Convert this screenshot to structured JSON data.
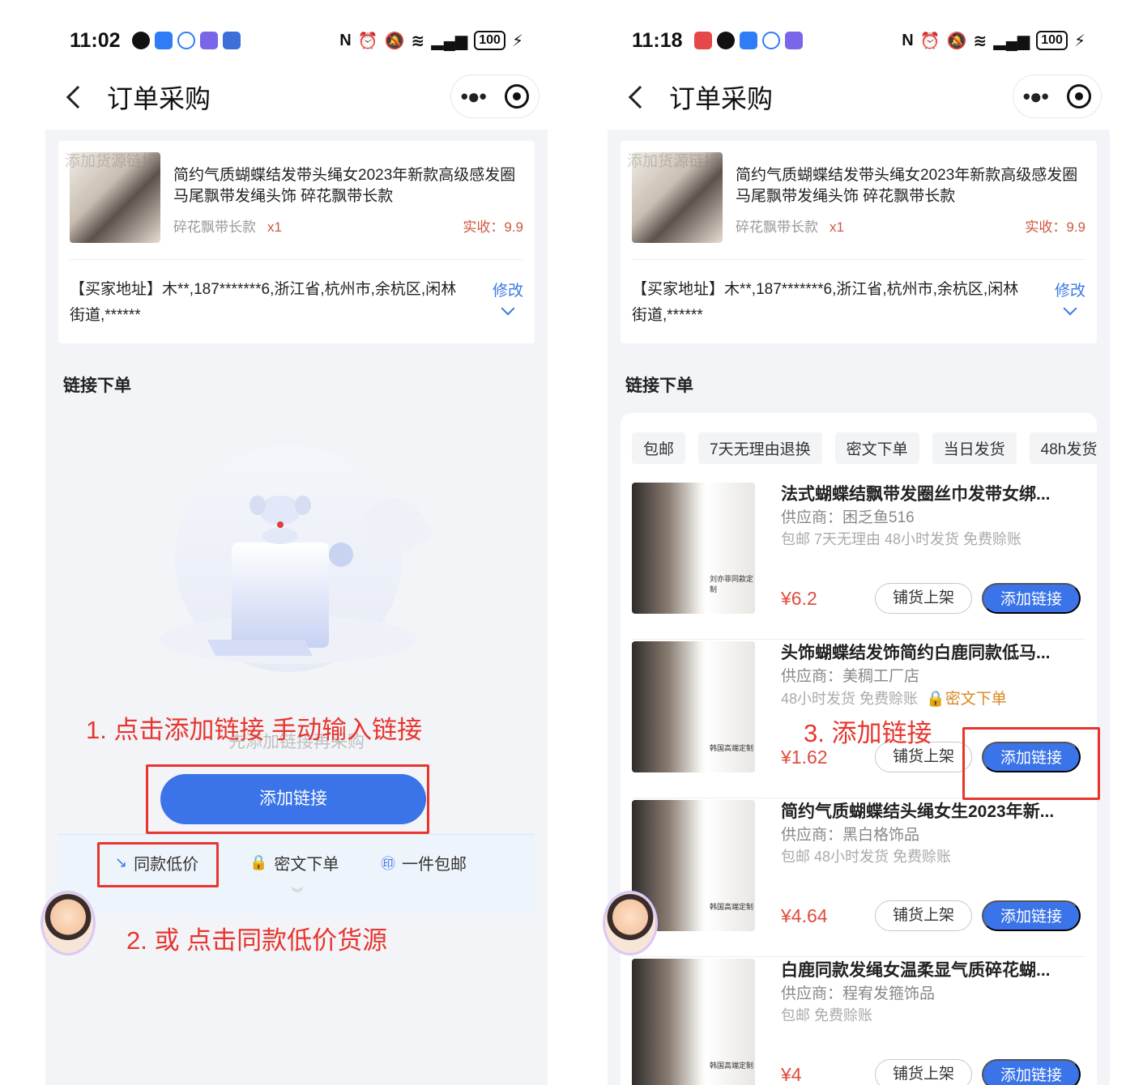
{
  "left": {
    "status": {
      "time": "11:02",
      "battery": "100"
    },
    "nav": {
      "title": "订单采购"
    },
    "order": {
      "watermark": "添加货源链接",
      "title": "简约气质蝴蝶结发带头绳女2023年新款高级感发圈马尾飘带发绳头饰 碎花飘带长款",
      "spec": "碎花飘带长款",
      "qty": "x1",
      "paid": "实收：9.9",
      "address": "【买家地址】木**,187*******6,浙江省,杭州市,余杭区,闲林街道,******",
      "modify": "修改"
    },
    "section_title": "链接下单",
    "empty_text": "先添加链接再采购",
    "add_link_button": "添加链接",
    "tabs": [
      "同款低价",
      "密文下单",
      "一件包邮"
    ],
    "tab_icons": [
      "trend-down-icon",
      "lock-icon",
      "mail-badge-icon"
    ],
    "annotations": {
      "a1": "1. 点击添加链接 手动输入链接",
      "a2": "2. 或 点击同款低价货源"
    }
  },
  "right": {
    "status": {
      "time": "11:18",
      "battery": "100"
    },
    "nav": {
      "title": "订单采购"
    },
    "order": {
      "watermark": "添加货源链接",
      "title": "简约气质蝴蝶结发带头绳女2023年新款高级感发圈马尾飘带发绳头饰 碎花飘带长款",
      "spec": "碎花飘带长款",
      "qty": "x1",
      "paid": "实收：9.9",
      "address": "【买家地址】木**,187*******6,浙江省,杭州市,余杭区,闲林街道,******",
      "modify": "修改"
    },
    "section_title": "链接下单",
    "chips": [
      "包邮",
      "7天无理由退换",
      "密文下单",
      "当日发货",
      "48h发货"
    ],
    "items": [
      {
        "title": "法式蝴蝶结飘带发圈丝巾发带女绑...",
        "supplier": "供应商：困乏鱼516",
        "tags": "包邮  7天无理由  48小时发货  免费赊账",
        "enc": "",
        "price": "¥6.2",
        "mini": "刘亦菲同款定制"
      },
      {
        "title": "头饰蝴蝶结发饰简约白鹿同款低马...",
        "supplier": "供应商：美稠工厂店",
        "tags": "48小时发货  免费赊账",
        "enc": "🔒密文下单",
        "price": "¥1.62",
        "mini": "韩国高端定制"
      },
      {
        "title": "简约气质蝴蝶结头绳女生2023年新...",
        "supplier": "供应商：黑白格饰品",
        "tags": "包邮  48小时发货  免费赊账",
        "enc": "",
        "price": "¥4.64",
        "mini": "韩国高端定制"
      },
      {
        "title": "白鹿同款发绳女温柔显气质碎花蝴...",
        "supplier": "供应商：程宥发箍饰品",
        "tags": "包邮  免费赊账",
        "enc": "",
        "price": "¥4",
        "mini": "韩国高端定制"
      }
    ],
    "buttons": {
      "list": "铺货上架",
      "add": "添加链接"
    },
    "annotations": {
      "a3": "3. 添加链接"
    }
  }
}
